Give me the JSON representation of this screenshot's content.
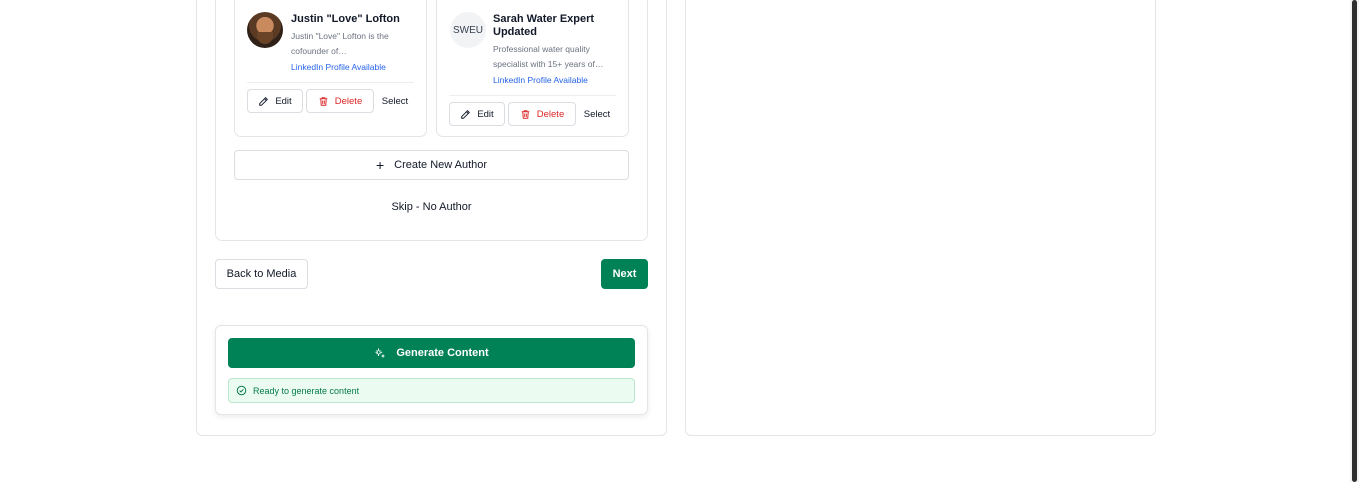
{
  "authors": [
    {
      "name": "Justin \"Love\" Lofton",
      "description": "Justin \"Love\" Lofton is the cofounder of…",
      "link": "LinkedIn Profile Available",
      "edit_label": "Edit",
      "delete_label": "Delete",
      "select_label": "Select"
    },
    {
      "initials": "SWEU",
      "name": "Sarah Water Expert Updated",
      "description": "Professional water quality specialist with 15+ years of…",
      "link": "LinkedIn Profile Available",
      "edit_label": "Edit",
      "delete_label": "Delete",
      "select_label": "Select"
    }
  ],
  "create_author_label": "Create New Author",
  "skip_label": "Skip - No Author",
  "nav": {
    "back_label": "Back to Media",
    "next_label": "Next"
  },
  "generate": {
    "button_label": "Generate Content",
    "status_text": "Ready to generate content"
  },
  "colors": {
    "primary_green": "#018156",
    "delete_red": "#dc2626",
    "link_blue": "#2563eb",
    "status_bg": "#ecfbf2"
  }
}
